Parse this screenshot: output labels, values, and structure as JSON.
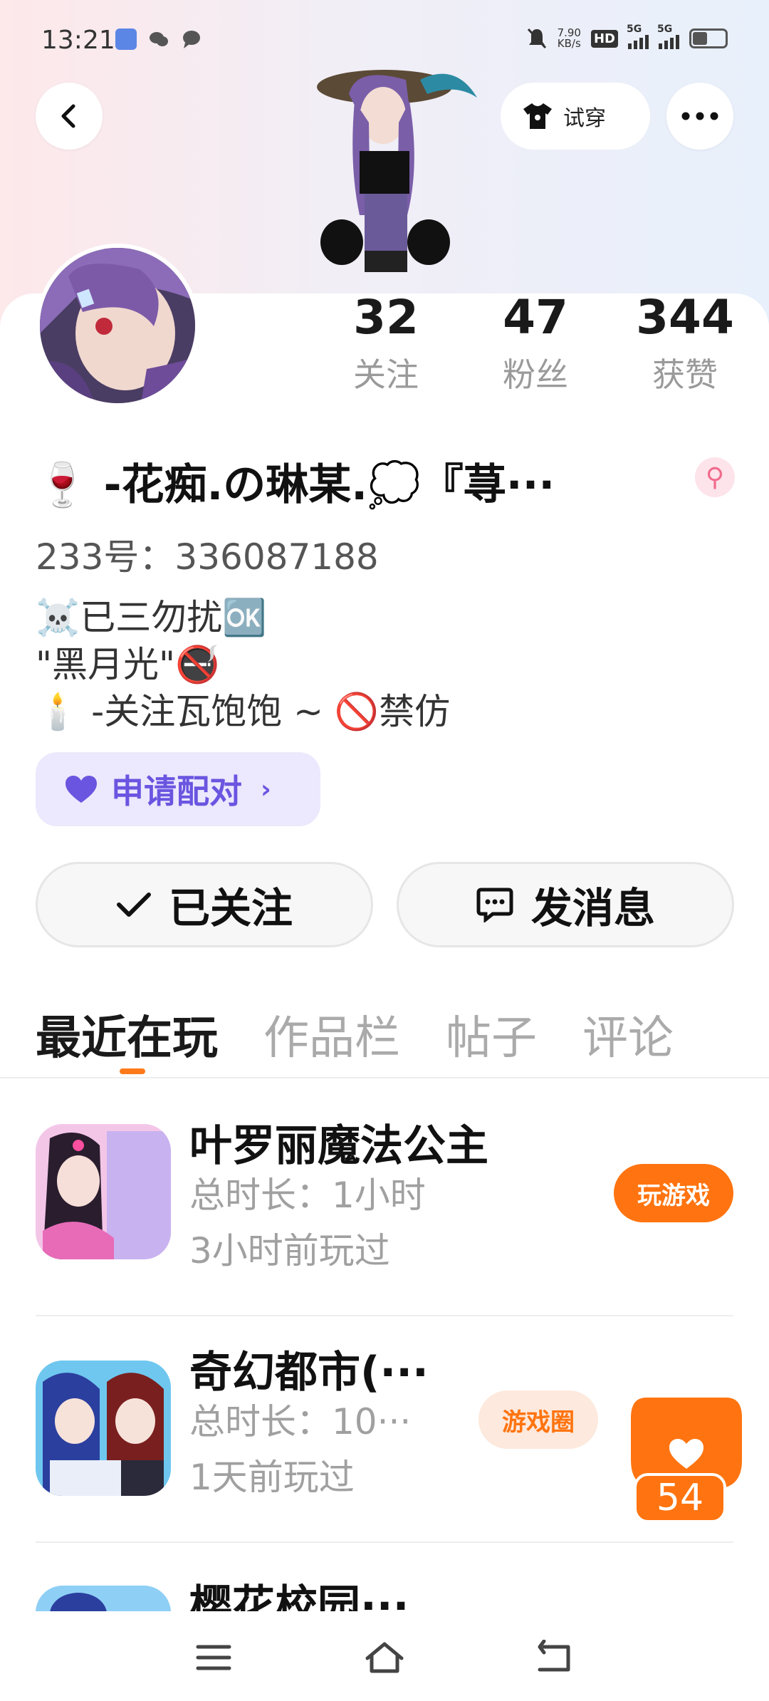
{
  "status_bar": {
    "time": "13:21",
    "net_speed_value": "7.90",
    "net_speed_unit": "KB/s",
    "hd_label": "HD",
    "sim1_label": "5G",
    "sim2_label": "5G"
  },
  "header": {
    "tryon_label": "试穿"
  },
  "stats": [
    {
      "num": "32",
      "label": "关注"
    },
    {
      "num": "47",
      "label": "粉丝"
    },
    {
      "num": "344",
      "label": "获赞"
    }
  ],
  "profile": {
    "nickname": "🍷 -花痴.の琳某.💭『荨···",
    "uid": "233号：336087188",
    "bio_line1": "☠️已三勿扰🆗",
    "bio_line2": "\"黑月光\"🚭",
    "bio_line3": "🕯️ -关注瓦饱饱 ~ 🚫禁仿",
    "gender_symbol": "⚲"
  },
  "actions": {
    "pair_label": "申请配对",
    "follow_label": "已关注",
    "message_label": "发消息"
  },
  "tabs": [
    "最近在玩",
    "作品栏",
    "帖子",
    "评论"
  ],
  "games": [
    {
      "title": "叶罗丽魔法公主",
      "duration": "总时长：1小时",
      "last_played": "3小时前玩过",
      "button": "玩游戏"
    },
    {
      "title": "奇幻都市(···",
      "duration": "总时长：10···",
      "last_played": "1天前玩过",
      "circle_tag": "游戏圈"
    },
    {
      "title": "樱花校园···"
    }
  ],
  "floating_like": {
    "count": "54"
  },
  "colors": {
    "accent": "#ff7410",
    "pair": "#6a55e0"
  }
}
